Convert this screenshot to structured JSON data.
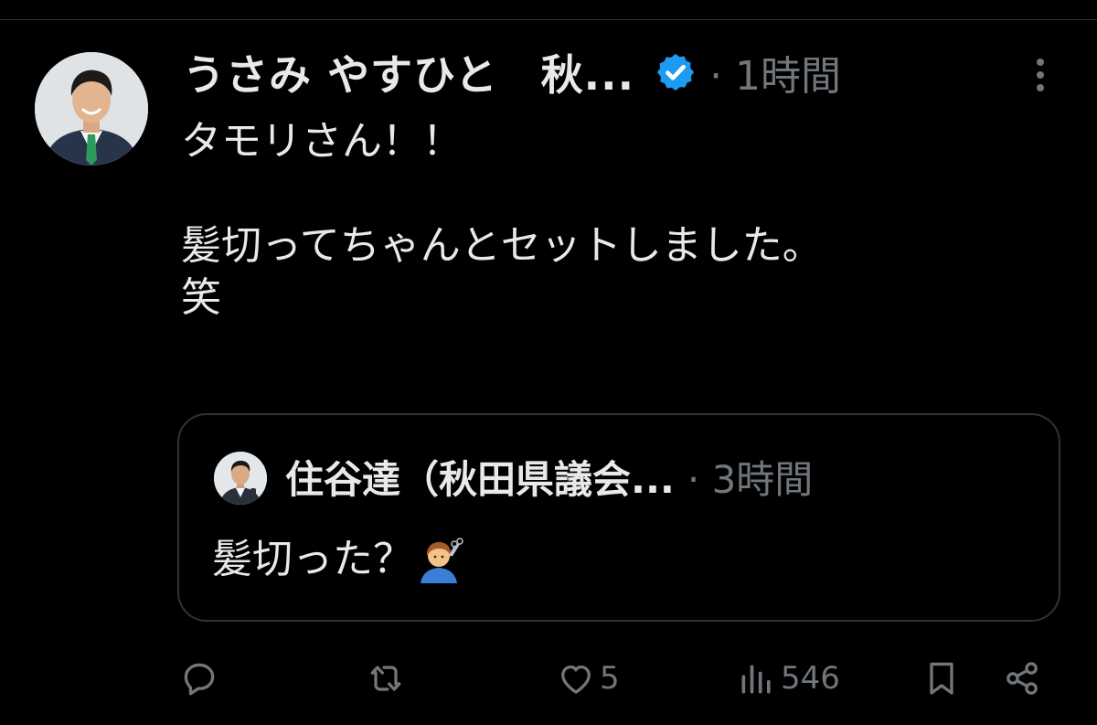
{
  "tweet": {
    "author_name": "うさみ やすひと　秋...",
    "time": "1時間",
    "text": "タモリさん！！\n\n髪切ってちゃんとセットしました。\n笑",
    "verified_badge_color": "#1d9bf0"
  },
  "quote": {
    "author_name": "住谷達（秋田県議会...",
    "time": "3時間",
    "text": "髪切った？"
  },
  "actions": {
    "reply": {
      "icon": "reply-icon",
      "count": ""
    },
    "retweet": {
      "icon": "retweet-icon",
      "count": ""
    },
    "like": {
      "icon": "heart-icon",
      "count": "5"
    },
    "views": {
      "icon": "views-icon",
      "count": "546"
    },
    "bookmark": {
      "icon": "bookmark-icon"
    },
    "share": {
      "icon": "share-icon"
    }
  },
  "colors": {
    "background": "#000000",
    "text_primary": "#e7e9ea",
    "text_secondary": "#71767b",
    "divider": "#2f3336"
  }
}
